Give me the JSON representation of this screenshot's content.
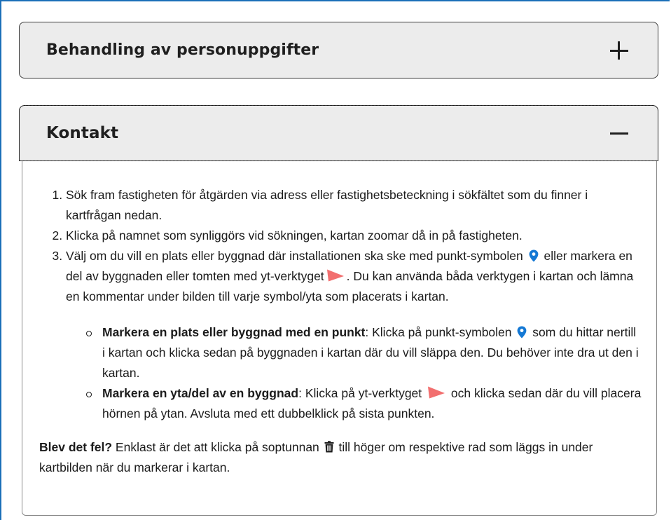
{
  "accordion": [
    {
      "title": "Behandling av personuppgifter",
      "expanded": false,
      "icon": "plus-icon"
    },
    {
      "title": "Kontakt",
      "expanded": true,
      "icon": "minus-icon"
    }
  ],
  "steps": [
    {
      "text": "Sök fram fastigheten för åtgärden via adress eller fastighetsbeteckning i sökfältet som du finner i kartfrågan nedan."
    },
    {
      "text": "Klicka på namnet som synliggörs vid sökningen, kartan zoomar då in på fastigheten."
    },
    {
      "part1": "Välj om du vill en plats eller byggnad där installationen ska ske med punkt-symbolen",
      "part2": "eller markera en del av byggnaden eller tomten med yt-verktyget",
      "part3": ". Du kan använda båda verktygen i kartan och lämna en kommentar under bilden till varje symbol/yta som placerats i kartan."
    }
  ],
  "substeps": [
    {
      "bold": "Markera en plats eller byggnad med en punkt",
      "part1": ": Klicka på punkt-symbolen",
      "part2": "som du hittar nertill i kartan och klicka sedan på byggnaden i kartan där du vill släppa den. Du behöver inte dra ut den i kartan."
    },
    {
      "bold": "Markera en yta/del av en byggnad",
      "part1": ": Klicka på yt-verktyget",
      "part2": "och klicka sedan där du vill placera hörnen på ytan. Avsluta med ett dubbelklick på sista punkten."
    }
  ],
  "note": {
    "bold": "Blev det fel?",
    "part1": " Enklast är det att klicka på soptunnan",
    "part2": " till höger om respektive rad som läggs in under kartbilden när du markerar i kartan."
  },
  "colors": {
    "pin": "#1478d4",
    "polygon": "#f26f6f",
    "frame": "#1b6fb8"
  }
}
